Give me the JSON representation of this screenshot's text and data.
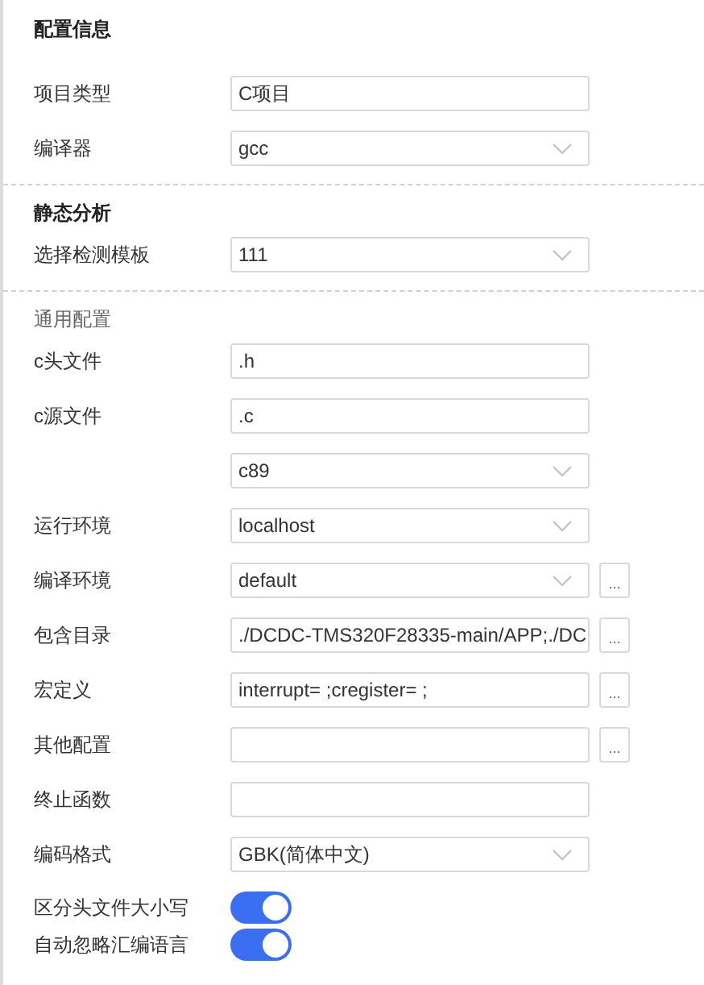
{
  "sections": [
    {
      "heading": "配置信息",
      "kind": "title",
      "rows": [
        {
          "label": "项目类型",
          "kind": "text",
          "value": "C项目"
        },
        {
          "label": "编译器",
          "kind": "select",
          "value": "gcc"
        }
      ]
    },
    {
      "heading": "静态分析",
      "kind": "title",
      "rows": [
        {
          "label": "选择检测模板",
          "kind": "select",
          "value": "111"
        }
      ]
    },
    {
      "heading": "通用配置",
      "kind": "group",
      "rows": [
        {
          "label": "c头文件",
          "kind": "text",
          "value": ".h"
        },
        {
          "label": "c源文件",
          "kind": "text",
          "value": ".c"
        },
        {
          "kind": "select",
          "value": "c89"
        },
        {
          "label": "运行环境",
          "kind": "select",
          "value": "localhost"
        },
        {
          "label": "编译环境",
          "kind": "select",
          "value": "default",
          "button": "..."
        },
        {
          "label": "包含目录",
          "kind": "text",
          "value": "./DCDC-TMS320F28335-main/APP;./DC",
          "button": "..."
        },
        {
          "label": "宏定义",
          "kind": "text",
          "value": "interrupt= ;cregister= ;",
          "button": "..."
        },
        {
          "label": "其他配置",
          "kind": "text",
          "button": "..."
        },
        {
          "label": "终止函数",
          "kind": "text"
        },
        {
          "label": "编码格式",
          "kind": "select",
          "value": "GBK(简体中文)"
        },
        {
          "label": "区分头文件大小写",
          "kind": "toggle",
          "on": true
        },
        {
          "label": "自动忽略汇编语言",
          "kind": "toggle",
          "on": true
        }
      ]
    }
  ]
}
